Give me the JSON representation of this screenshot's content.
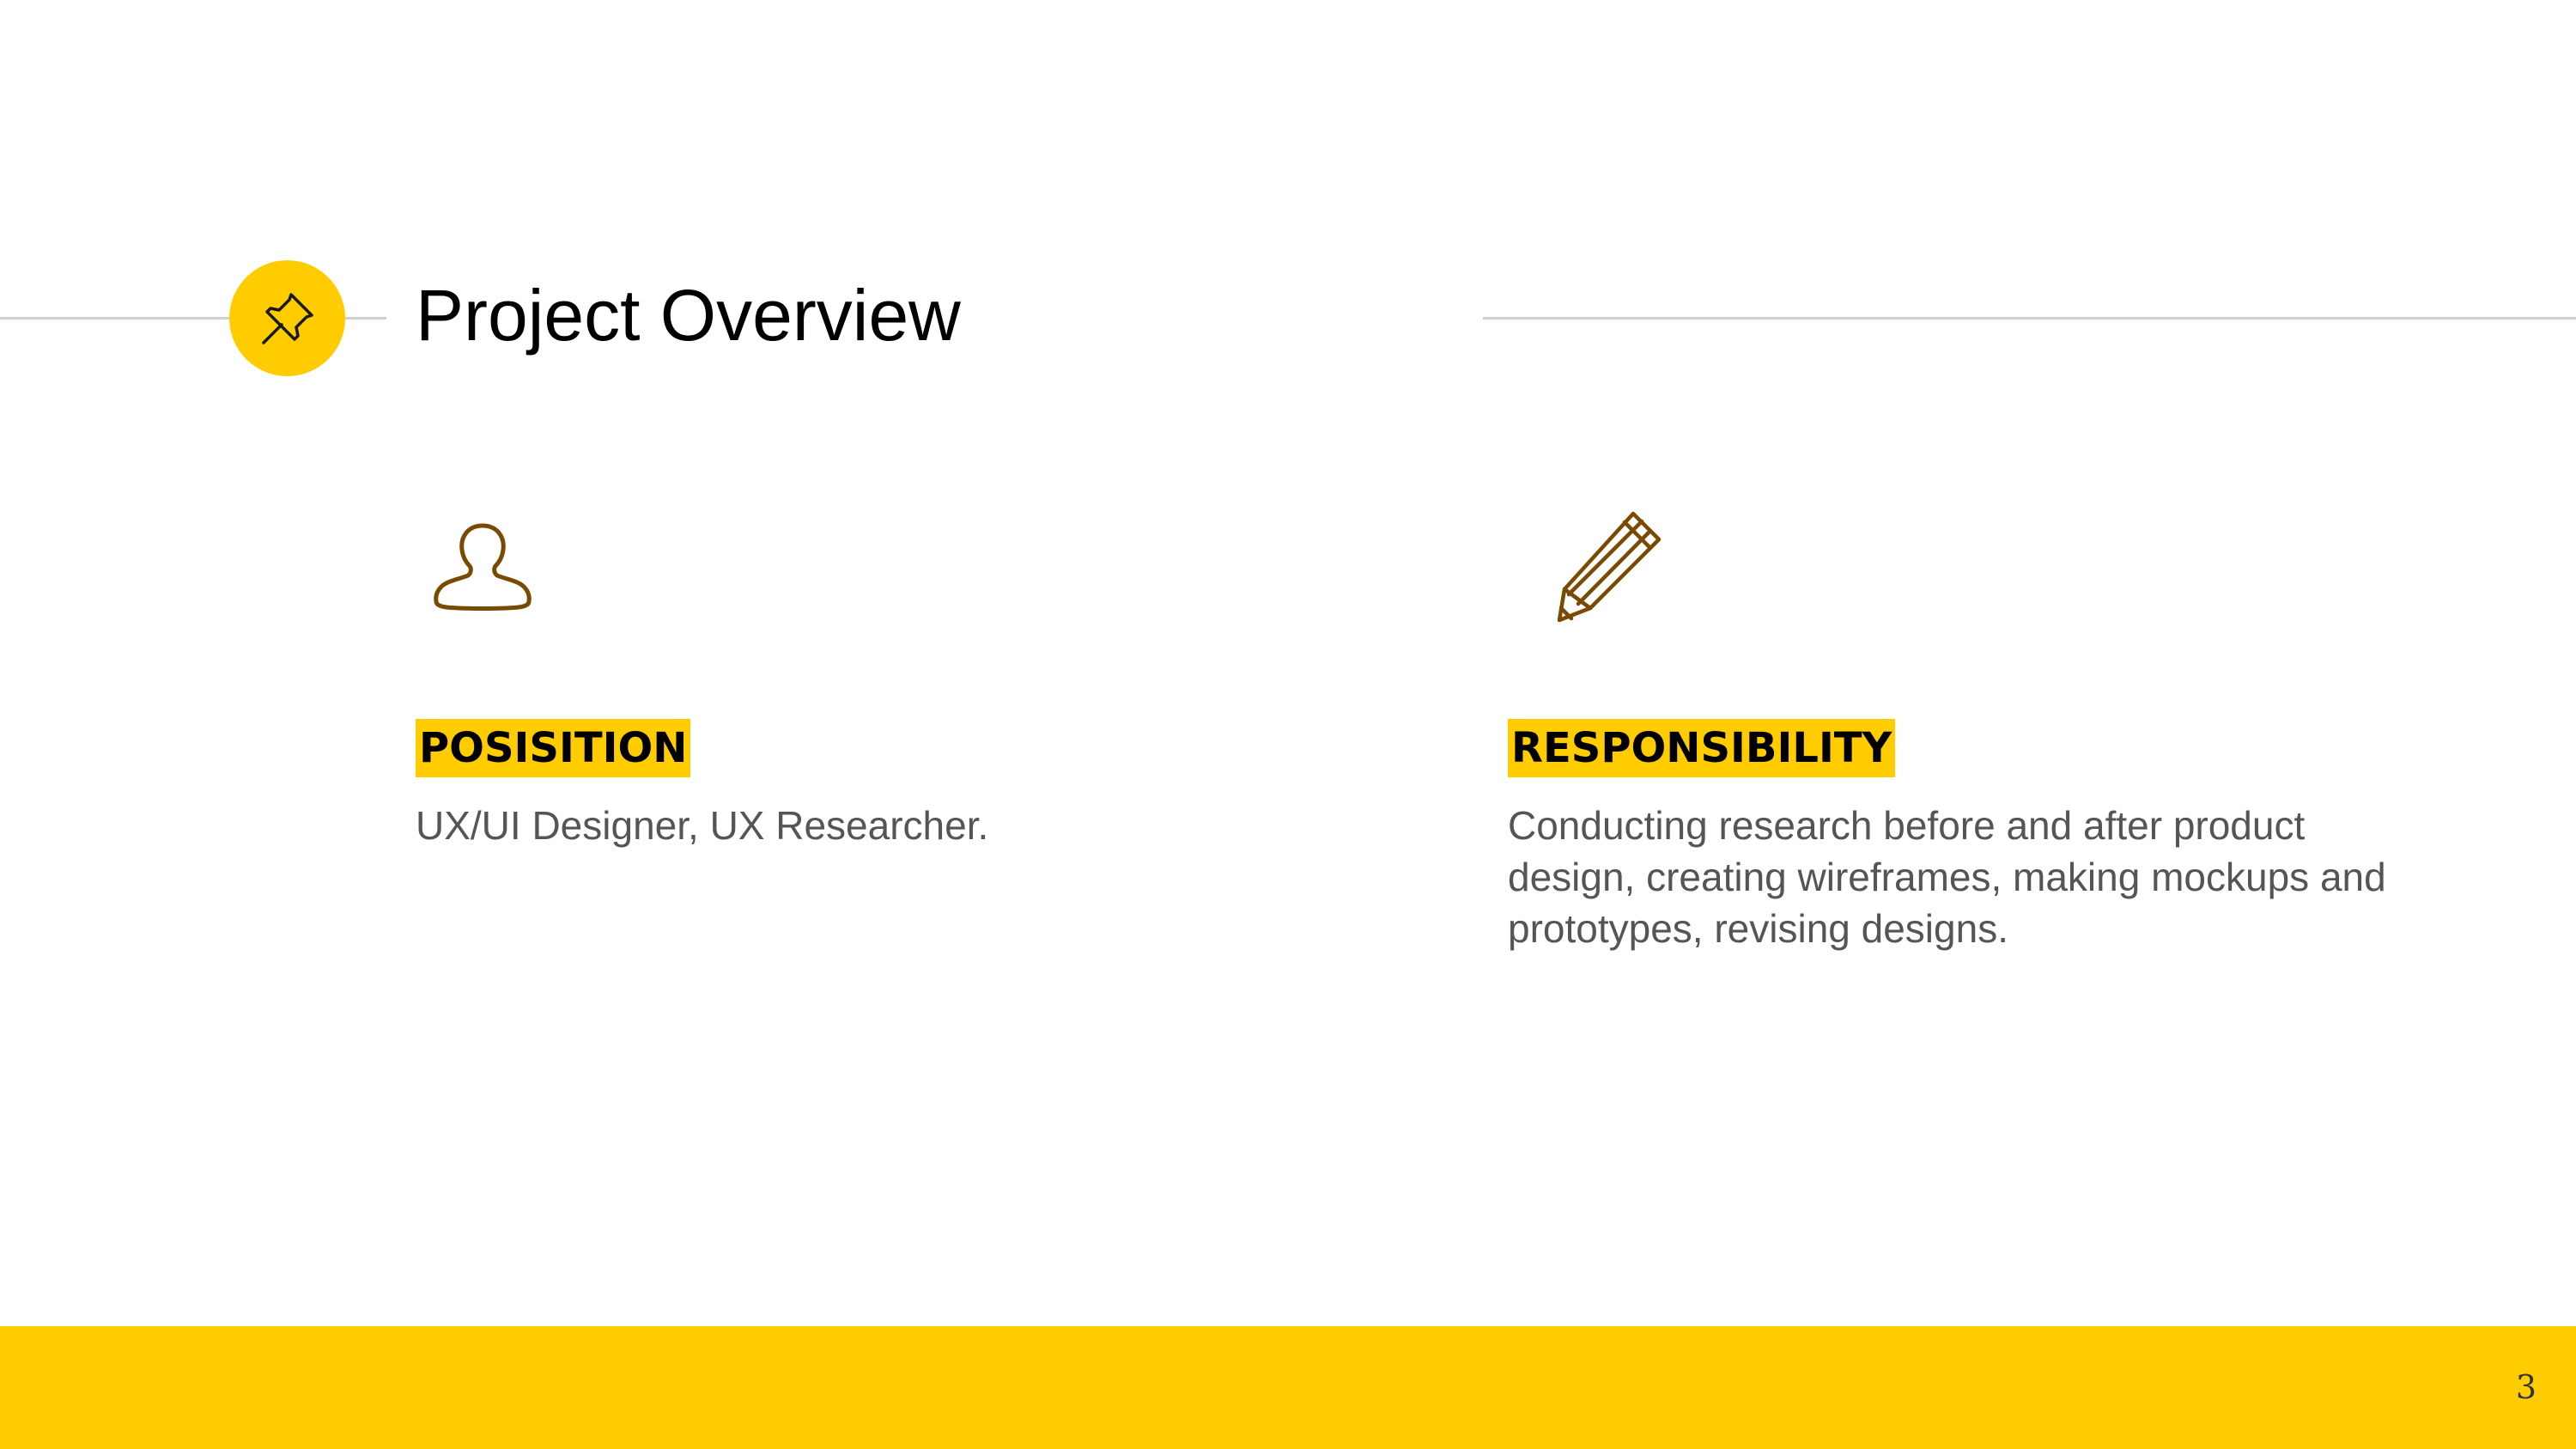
{
  "header": {
    "title": "Project Overview",
    "badge_icon": "pushpin-icon"
  },
  "sections": [
    {
      "icon": "person-icon",
      "label": "POSISITION",
      "text": "UX/UI Designer, UX Researcher."
    },
    {
      "icon": "pencil-icon",
      "label": "RESPONSIBILITY",
      "text": "Conducting research before and after product design, creating wireframes, making mockups and prototypes, revising designs."
    }
  ],
  "footer": {
    "page_number": "3"
  },
  "colors": {
    "accent": "#FFCC00",
    "icon_stroke": "#7A4A00",
    "body_text": "#555555",
    "rule": "#D0D0D0"
  }
}
